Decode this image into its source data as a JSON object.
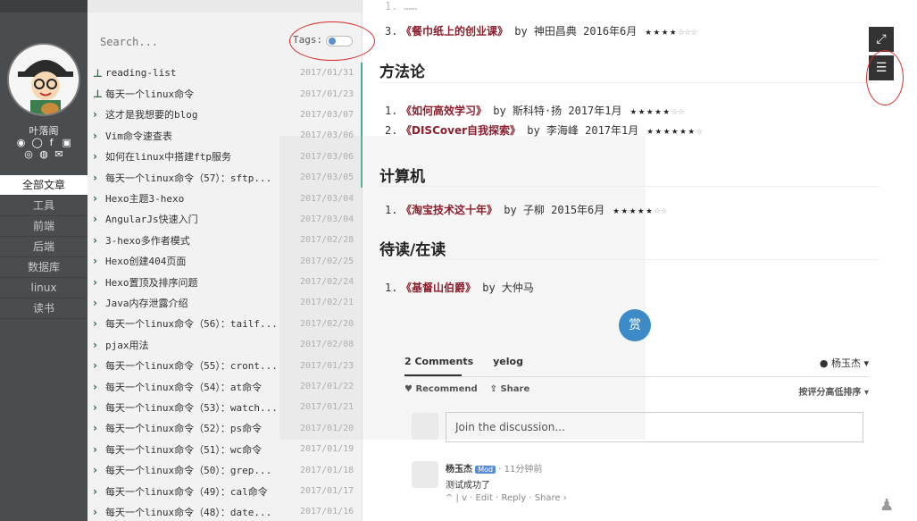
{
  "sidebar": {
    "author": "叶落阁",
    "social_icons": [
      "rss-icon",
      "github-icon",
      "facebook-icon",
      "linkedin-icon",
      "weibo-icon",
      "douban-icon",
      "mail-icon"
    ],
    "nav": [
      "全部文章",
      "工具",
      "前端",
      "后端",
      "数据库",
      "linux",
      "读书"
    ],
    "active_index": 0
  },
  "list_panel": {
    "search_placeholder": "Search...",
    "tags_label": "Tags:",
    "items": [
      {
        "icon": "pin-icon",
        "title": "reading-list",
        "date": "2017/01/31"
      },
      {
        "icon": "pin-icon",
        "title": "每天一个linux命令",
        "date": "2017/01/23"
      },
      {
        "icon": "chevron-right-icon",
        "title": "这才是我想要的blog",
        "date": "2017/03/07"
      },
      {
        "icon": "chevron-right-icon",
        "title": "Vim命令速查表",
        "date": "2017/03/06"
      },
      {
        "icon": "chevron-right-icon",
        "title": "如何在linux中搭建ftp服务",
        "date": "2017/03/06"
      },
      {
        "icon": "chevron-right-icon",
        "title": "每天一个linux命令（57）：sftp...",
        "date": "2017/03/05"
      },
      {
        "icon": "chevron-right-icon",
        "title": "Hexo主题3-hexo",
        "date": "2017/03/04"
      },
      {
        "icon": "chevron-right-icon",
        "title": "AngularJs快速入门",
        "date": "2017/03/04"
      },
      {
        "icon": "chevron-right-icon",
        "title": "3-hexo多作者模式",
        "date": "2017/02/28"
      },
      {
        "icon": "chevron-right-icon",
        "title": "Hexo创建404页面",
        "date": "2017/02/25"
      },
      {
        "icon": "chevron-right-icon",
        "title": "Hexo置顶及排序问题",
        "date": "2017/02/24"
      },
      {
        "icon": "chevron-right-icon",
        "title": "Java内存泄露介绍",
        "date": "2017/02/21"
      },
      {
        "icon": "chevron-right-icon",
        "title": "每天一个linux命令（56）：tailf...",
        "date": "2017/02/20"
      },
      {
        "icon": "chevron-right-icon",
        "title": "pjax用法",
        "date": "2017/02/08"
      },
      {
        "icon": "chevron-right-icon",
        "title": "每天一个linux命令（55）：cront...",
        "date": "2017/01/23"
      },
      {
        "icon": "chevron-right-icon",
        "title": "每天一个linux命令（54）：at命令",
        "date": "2017/01/22"
      },
      {
        "icon": "chevron-right-icon",
        "title": "每天一个linux命令（53）：watch...",
        "date": "2017/01/21"
      },
      {
        "icon": "chevron-right-icon",
        "title": "每天一个linux命令（52）：ps命令",
        "date": "2017/01/20"
      },
      {
        "icon": "chevron-right-icon",
        "title": "每天一个linux命令（51）：wc命令",
        "date": "2017/01/19"
      },
      {
        "icon": "chevron-right-icon",
        "title": "每天一个linux命令（50）：grep...",
        "date": "2017/01/18"
      },
      {
        "icon": "chevron-right-icon",
        "title": "每天一个linux命令（49）：cal命令",
        "date": "2017/01/17"
      },
      {
        "icon": "chevron-right-icon",
        "title": "每天一个linux命令（48）：date...",
        "date": "2017/01/16"
      }
    ]
  },
  "main": {
    "books_top": [
      {
        "num": "3.",
        "title": "《餐巾纸上的创业课》",
        "meta": "by 神田昌典 2016年6月",
        "stars": 4,
        "total": 7
      }
    ],
    "sections": [
      {
        "heading": "方法论",
        "books": [
          {
            "num": "1.",
            "title": "《如何高效学习》",
            "meta": "by 斯科特·扬 2017年1月",
            "stars": 5,
            "total": 7
          },
          {
            "num": "2.",
            "title": "《DISCover自我探索》",
            "meta": "by 李海峰 2017年1月",
            "stars": 6,
            "total": 7
          }
        ]
      },
      {
        "heading": "计算机",
        "books": [
          {
            "num": "1.",
            "title": "《淘宝技术这十年》",
            "meta": "by 子柳 2015年6月",
            "stars": 5,
            "total": 7
          }
        ]
      },
      {
        "heading": "待读/在读",
        "books": [
          {
            "num": "1.",
            "title": "《基督山伯爵》",
            "meta": "by 大仲马",
            "stars": 0,
            "total": 0
          }
        ]
      }
    ],
    "reward_label": "赏"
  },
  "comments": {
    "count_label": "2 Comments",
    "site_label": "yelog",
    "user_label": "杨玉杰",
    "recommend_label": "Recommend",
    "share_label": "Share",
    "sort_label": "按评分高低排序",
    "input_placeholder": "Join the discussion...",
    "first": {
      "author": "杨玉杰",
      "badge": "Mod",
      "time": "11分钟前",
      "text": "测试成功了",
      "actions": "^ | v · Edit · Reply · Share ›"
    }
  },
  "tools": [
    "expand-icon",
    "toc-list-icon"
  ],
  "colors": {
    "accent": "#8b1e2d",
    "sidebar": "#4a4d4f",
    "reward": "#3c8bc8",
    "annotation": "#d62b2b"
  }
}
